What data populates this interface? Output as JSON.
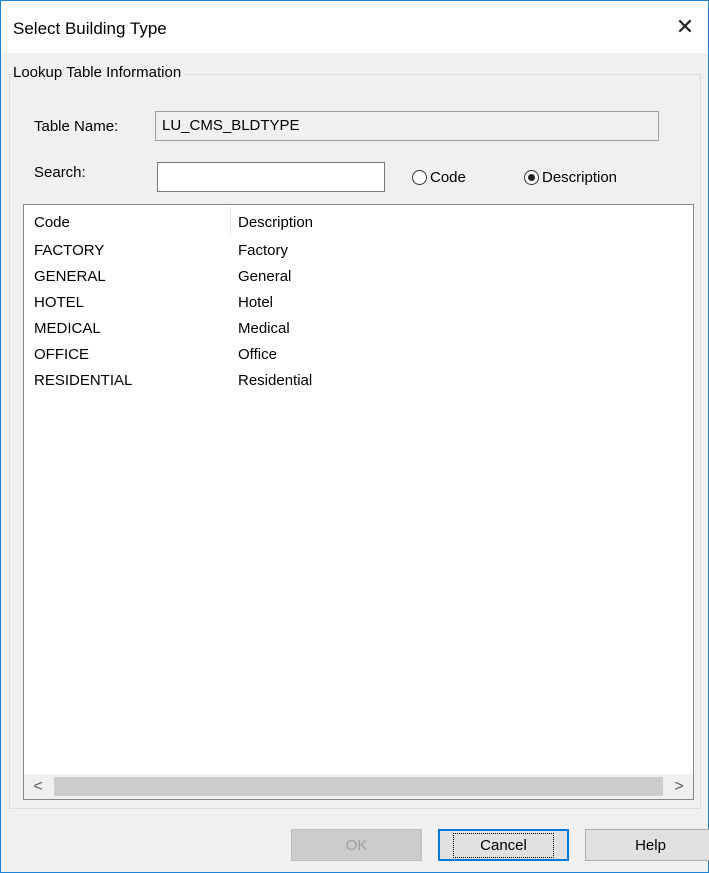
{
  "window": {
    "title": "Select Building Type",
    "close_glyph": "✕"
  },
  "group": {
    "label": "Lookup Table Information"
  },
  "table_name": {
    "label": "Table Name:",
    "value": "LU_CMS_BLDTYPE"
  },
  "search": {
    "label": "Search:",
    "value": "",
    "placeholder": ""
  },
  "search_mode": {
    "options": [
      {
        "label": "Code",
        "checked": false
      },
      {
        "label": "Description",
        "checked": true
      }
    ]
  },
  "list": {
    "columns": [
      "Code",
      "Description"
    ],
    "rows": [
      {
        "code": "FACTORY",
        "description": "Factory"
      },
      {
        "code": "GENERAL",
        "description": "General"
      },
      {
        "code": "HOTEL",
        "description": "Hotel"
      },
      {
        "code": "MEDICAL",
        "description": "Medical"
      },
      {
        "code": "OFFICE",
        "description": "Office"
      },
      {
        "code": "RESIDENTIAL",
        "description": "Residential"
      }
    ],
    "scroll_left_glyph": "<",
    "scroll_right_glyph": ">"
  },
  "buttons": {
    "ok": "OK",
    "cancel": "Cancel",
    "help": "Help"
  }
}
